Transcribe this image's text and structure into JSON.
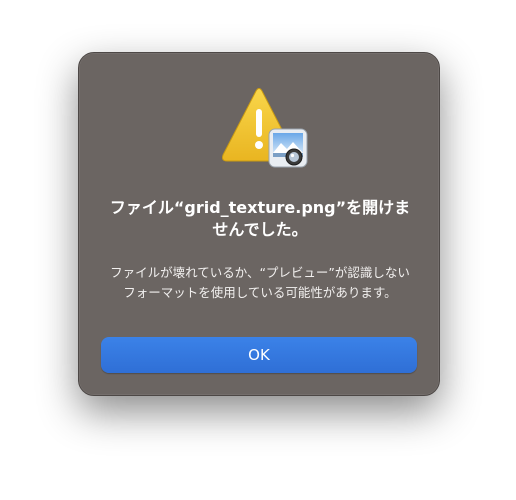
{
  "dialog": {
    "title": "ファイル“grid_texture.png”を開けませんでした。",
    "message": "ファイルが壊れているか、“プレビュー”が認識しないフォーマットを使用している可能性があります。",
    "ok_label": "OK",
    "icon": "warning-triangle-with-preview-app-icon"
  },
  "colors": {
    "dialog_background": "#6b6562",
    "button_accent": "#3b82e8",
    "warning_yellow": "#f2c230"
  }
}
